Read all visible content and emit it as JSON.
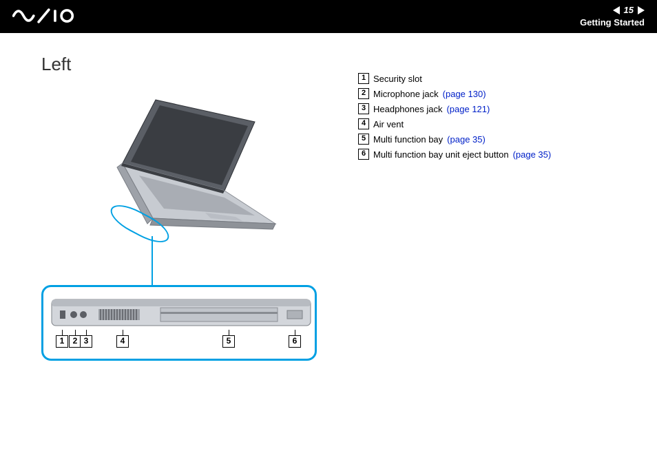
{
  "header": {
    "logo_alt": "VAIO",
    "page_number": "15",
    "section": "Getting Started"
  },
  "page": {
    "title": "Left"
  },
  "callouts": [
    "1",
    "2",
    "3",
    "4",
    "5",
    "6"
  ],
  "legend": {
    "items": [
      {
        "num": "1",
        "label": "Security slot",
        "link": ""
      },
      {
        "num": "2",
        "label": "Microphone jack",
        "link": "(page 130)"
      },
      {
        "num": "3",
        "label": "Headphones jack",
        "link": "(page 121)"
      },
      {
        "num": "4",
        "label": "Air vent",
        "link": ""
      },
      {
        "num": "5",
        "label": "Multi function bay",
        "link": "(page 35)"
      },
      {
        "num": "6",
        "label": "Multi function bay unit eject button",
        "link": "(page 35)"
      }
    ]
  }
}
